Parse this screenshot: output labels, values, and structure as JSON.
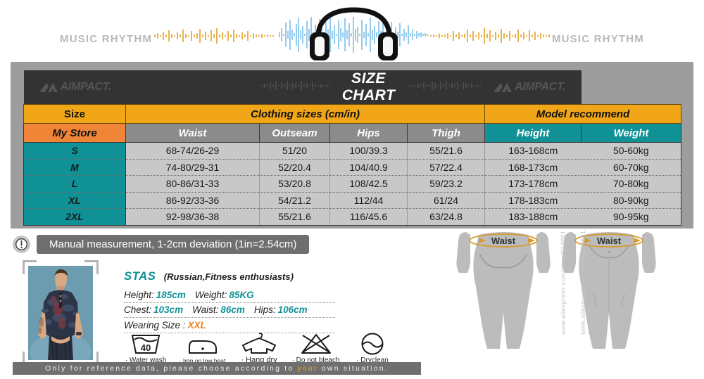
{
  "banner": {
    "left_text": "MUSIC RHYTHM",
    "right_text": "MUSIC RHYTHM",
    "headphones_icon": "headphones-icon",
    "waveform_icon": "audio-waveform-icon"
  },
  "chart": {
    "title": "SIZE CHART",
    "brand": "AIMPACT.",
    "brand_mark_icon": "aimpact-logo-icon",
    "group_headers": {
      "size": "Size",
      "clothing": "Clothing sizes  (cm/in)",
      "model": "Model recommend"
    },
    "columns": [
      "My Store",
      "Waist",
      "Outseam",
      "Hips",
      "Thigh",
      "Height",
      "Weight"
    ],
    "rows": [
      {
        "size": "S",
        "waist": "68-74/26-29",
        "outseam": "51/20",
        "hips": "100/39.3",
        "thigh": "55/21.6",
        "height": "163-168cm",
        "weight": "50-60kg"
      },
      {
        "size": "M",
        "waist": "74-80/29-31",
        "outseam": "52/20.4",
        "hips": "104/40.9",
        "thigh": "57/22.4",
        "height": "168-173cm",
        "weight": "60-70kg"
      },
      {
        "size": "L",
        "waist": "80-86/31-33",
        "outseam": "53/20.8",
        "hips": "108/42.5",
        "thigh": "59/23.2",
        "height": "173-178cm",
        "weight": "70-80kg"
      },
      {
        "size": "XL",
        "waist": "86-92/33-36",
        "outseam": "54/21.2",
        "hips": "112/44",
        "thigh": "61/24",
        "height": "178-183cm",
        "weight": "80-90kg"
      },
      {
        "size": "2XL",
        "waist": "92-98/36-38",
        "outseam": "55/21.6",
        "hips": "116/45.6",
        "thigh": "63/24.8",
        "height": "183-188cm",
        "weight": "90-95kg"
      }
    ]
  },
  "note": {
    "icon": "exclamation-circle-icon",
    "text": "Manual measurement, 1-2cm deviation (1in=2.54cm)"
  },
  "model": {
    "photo_alt": "male-model-camo-tshirt",
    "name": "STAS",
    "role": "(Russian,Fitness enthusiasts)",
    "specs": [
      {
        "label": "Height:",
        "value": "185cm"
      },
      {
        "label": "Weight:",
        "value": "85KG"
      },
      {
        "label": "Chest:",
        "value": "103cm"
      },
      {
        "label": "Waist:",
        "value": "86cm"
      },
      {
        "label": "Hips:",
        "value": "106cm"
      }
    ],
    "wearing_size_label": "Wearing Size :",
    "wearing_size_value": "XXL"
  },
  "care": [
    {
      "icon": "water-wash-icon",
      "temperature": "40",
      "label": "· Water wash"
    },
    {
      "icon": "iron-low-heat-icon",
      "label": "· Iron on low heat"
    },
    {
      "icon": "hang-dry-icon",
      "label": "· Hang dry"
    },
    {
      "icon": "do-not-bleach-icon",
      "label": "· Do not bleach"
    },
    {
      "icon": "dryclean-icon",
      "label": "· Dryclean"
    }
  ],
  "silhouettes": {
    "back_waist_label": "Waist",
    "front_waist_label": "Waist",
    "watermark": "www.aliexpress.com/store/114881"
  },
  "footer": {
    "text_before": "Only for reference data, please choose according to ",
    "text_highlight": "your",
    "text_after": " own situation."
  },
  "colors": {
    "amber": "#F0A616",
    "orange": "#F08538",
    "teal": "#0F9196",
    "size_yellow": "#D9E533",
    "dark_header": "#333333",
    "frame_gray": "#9d9d9d",
    "cell_gray": "#c8c8c8"
  }
}
